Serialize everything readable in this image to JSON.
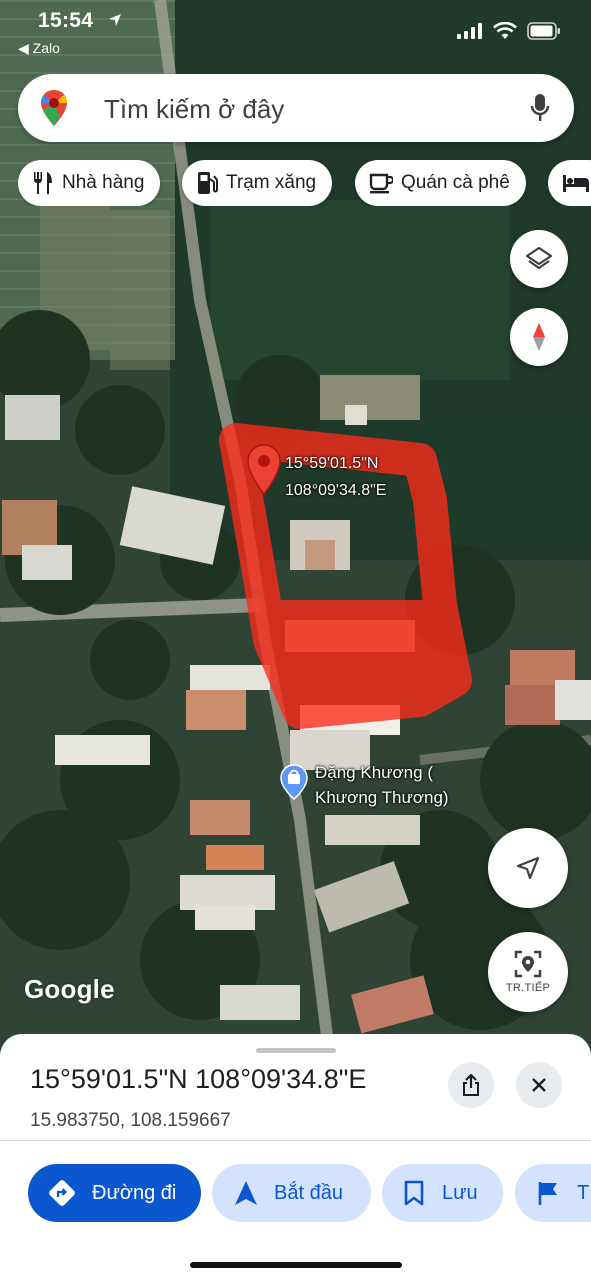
{
  "status_bar": {
    "time": "15:54",
    "back_app": "◀ Zalo"
  },
  "search": {
    "placeholder": "Tìm kiếm ở đây"
  },
  "categories": [
    {
      "label": "Nhà hàng",
      "icon": "fork-knife-icon"
    },
    {
      "label": "Trạm xăng",
      "icon": "gas-station-icon"
    },
    {
      "label": "Quán cà phê",
      "icon": "coffee-cup-icon"
    },
    {
      "label": "",
      "icon": "hotel-bed-icon"
    }
  ],
  "map": {
    "pin_label_line1": "15°59'01.5\"N",
    "pin_label_line2": "108°09'34.8\"E",
    "poi_line1": "Đặng Khương (",
    "poi_line2": "Khương Thương)",
    "attribution": "Google",
    "live_view_label": "TR.TIẾP"
  },
  "place_sheet": {
    "title": "15°59'01.5\"N 108°09'34.8\"E",
    "decimal": "15.983750, 108.159667"
  },
  "actions": [
    {
      "label": "Đường đi",
      "icon": "directions-icon",
      "style": "primary"
    },
    {
      "label": "Bắt đầu",
      "icon": "navigation-arrow-icon",
      "style": "secondary"
    },
    {
      "label": "Lưu",
      "icon": "bookmark-icon",
      "style": "secondary"
    },
    {
      "label": "T",
      "icon": "flag-icon",
      "style": "secondary"
    }
  ],
  "colors": {
    "primary_button": "#0b57d0",
    "secondary_button": "#d3e3fd",
    "highlight_region": "#ff2a1a"
  }
}
